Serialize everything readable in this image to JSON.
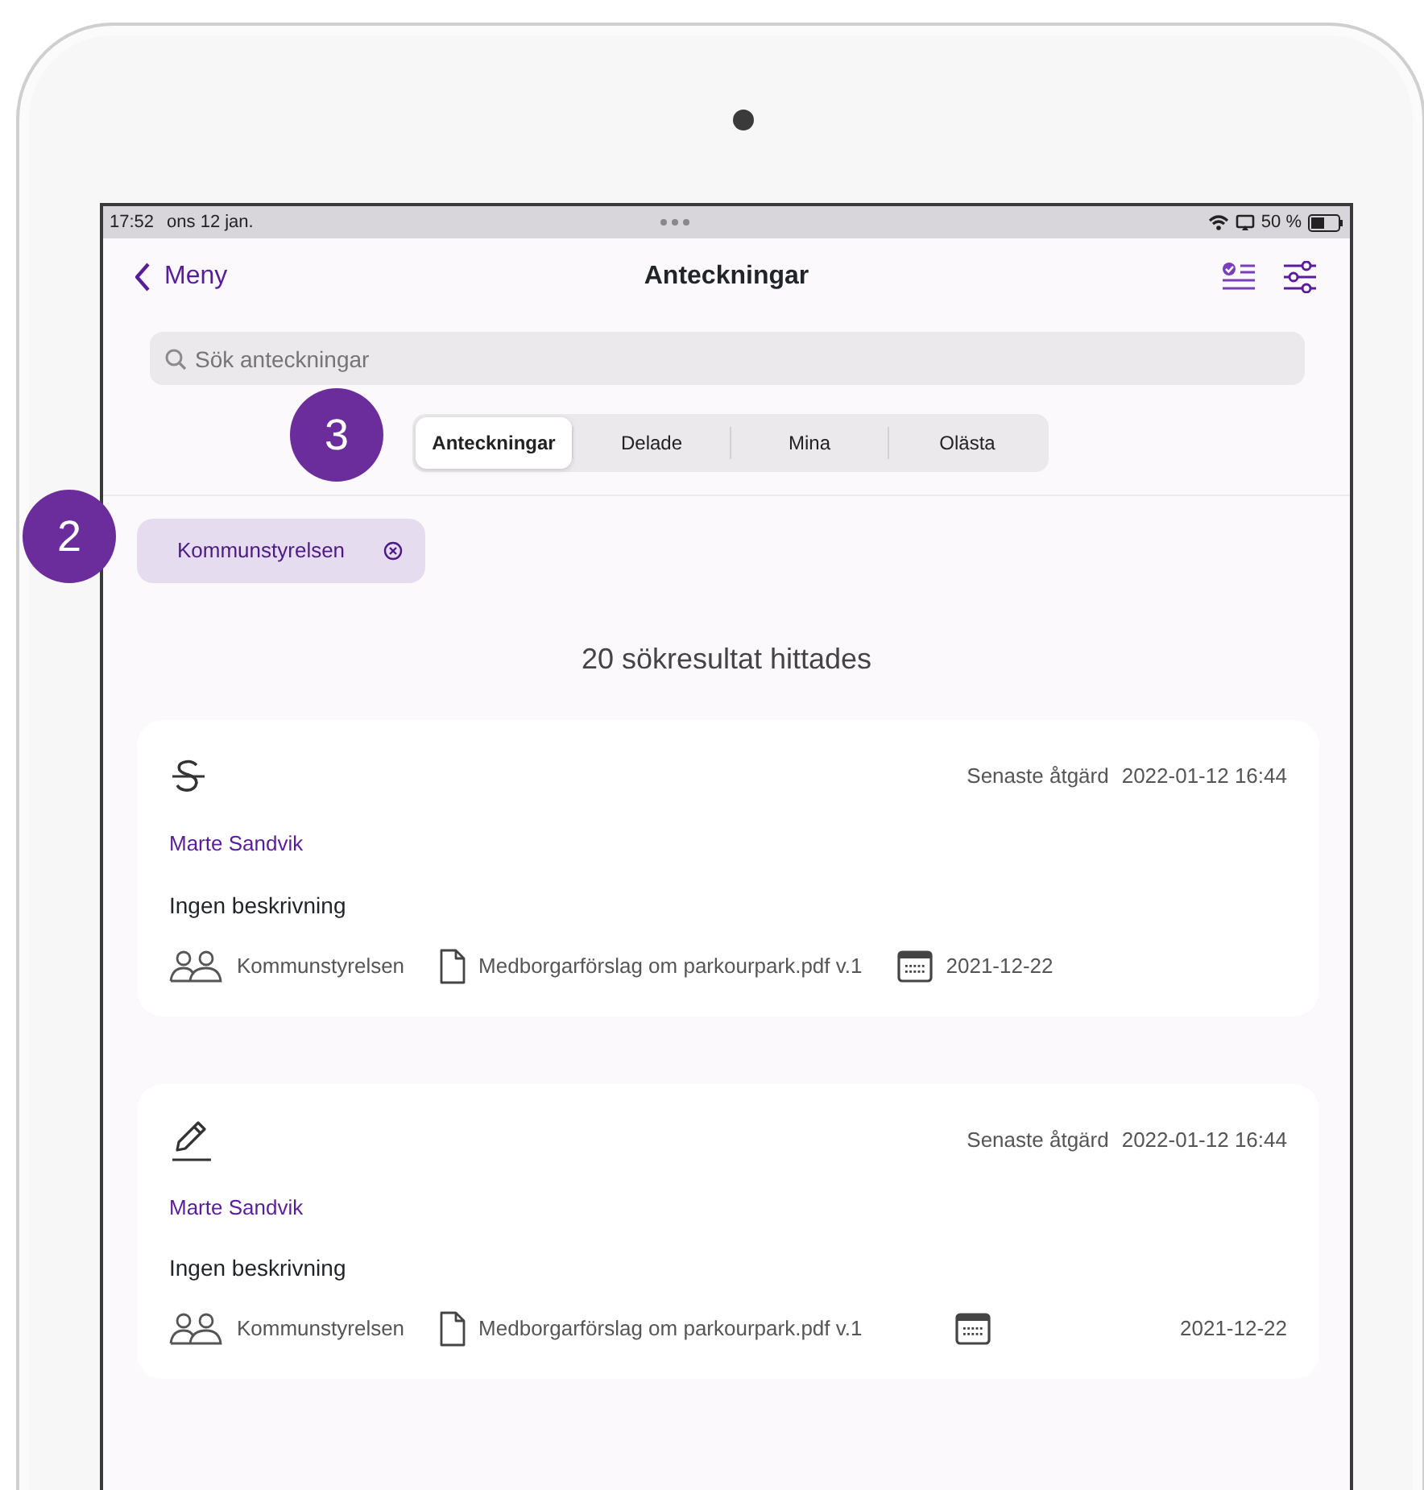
{
  "status_bar": {
    "time": "17:52",
    "date": "ons 12 jan.",
    "battery": "50 %"
  },
  "nav": {
    "back": "Meny",
    "title": "Anteckningar"
  },
  "search": {
    "placeholder": "Sök anteckningar"
  },
  "segments_marker": "3",
  "segments": [
    {
      "label": "Anteckningar",
      "selected": true
    },
    {
      "label": "Delade",
      "selected": false
    },
    {
      "label": "Mina",
      "selected": false
    },
    {
      "label": "Olästa",
      "selected": false
    }
  ],
  "filter_marker": "2",
  "filter_chip": {
    "label": "Kommunstyrelsen"
  },
  "result_count": "20 sökresultat hittades",
  "notes": [
    {
      "kind": "strikethrough",
      "last_action_label": "Senaste åtgärd",
      "last_action": "2022-01-12 16:44",
      "author": "Marte Sandvik",
      "description": "Ingen beskrivning",
      "group": "Kommunstyrelsen",
      "document": "Medborgarförslag om parkourpark.pdf v.1",
      "date": "2021-12-22",
      "date_right": false
    },
    {
      "kind": "edit",
      "last_action_label": "Senaste åtgärd",
      "last_action": "2022-01-12 16:44",
      "author": "Marte Sandvik",
      "description": "Ingen beskrivning",
      "group": "Kommunstyrelsen",
      "document": "Medborgarförslag om parkourpark.pdf v.1",
      "date": "2021-12-22",
      "date_right": true
    }
  ]
}
